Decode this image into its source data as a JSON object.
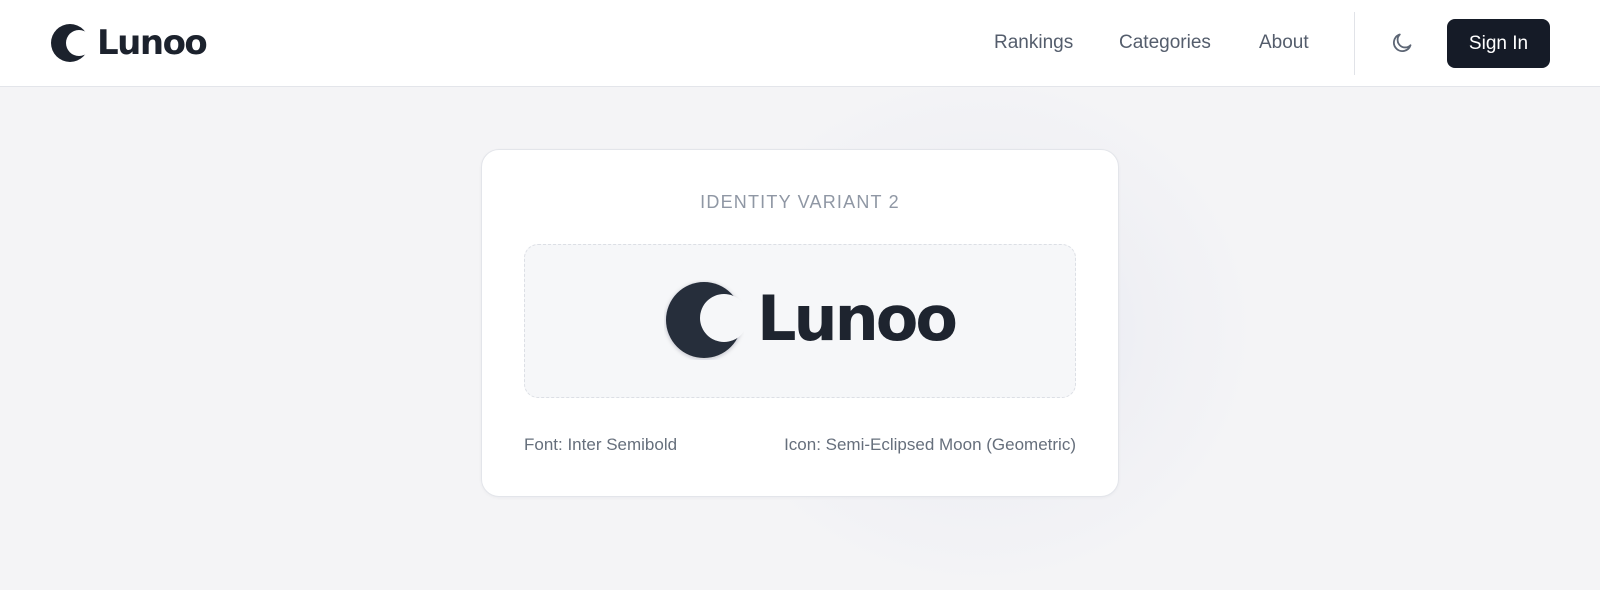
{
  "brand": {
    "name": "Lunoo",
    "icon": "crescent-moon-icon"
  },
  "nav": {
    "links": [
      "Rankings",
      "Categories",
      "About"
    ],
    "theme_toggle_icon": "moon-icon",
    "signin_label": "Sign In"
  },
  "card": {
    "title": "IDENTITY VARIANT 2",
    "preview": {
      "name": "Lunoo",
      "icon": "semi-eclipsed-moon-icon"
    },
    "font_label": "Font: Inter Semibold",
    "icon_label": "Icon: Semi-Eclipsed Moon (Geometric)"
  },
  "colors": {
    "brand_dark": "#1c222d",
    "button_bg": "#151b27",
    "page_bg": "#f4f4f6",
    "muted_text": "#8f97a4"
  }
}
